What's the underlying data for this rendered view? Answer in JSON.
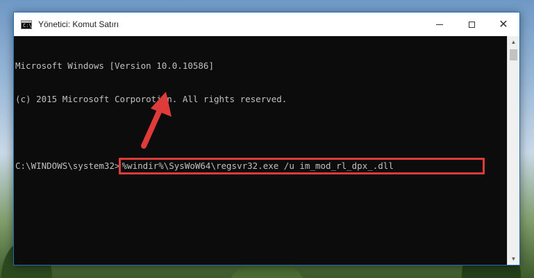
{
  "window": {
    "title": "Yönetici: Komut Satırı",
    "icon_label": "C:\\",
    "controls": {
      "minimize": "minimize",
      "maximize": "maximize",
      "close": "✕"
    }
  },
  "console": {
    "lines": [
      "Microsoft Windows [Version 10.0.10586]",
      "(c) 2015 Microsoft Corporotion. All rights reserved.",
      ""
    ],
    "prompt": "C:\\WINDOWS\\system32>",
    "command": "%windir%\\SysWoW64\\regsvr32.exe /u im_mod_rl_dpx_.dll"
  },
  "annotation": {
    "highlight_color": "#e03b3b",
    "arrow_color": "#e03b3b"
  },
  "scrollbar": {
    "up": "▲",
    "down": "▼"
  }
}
